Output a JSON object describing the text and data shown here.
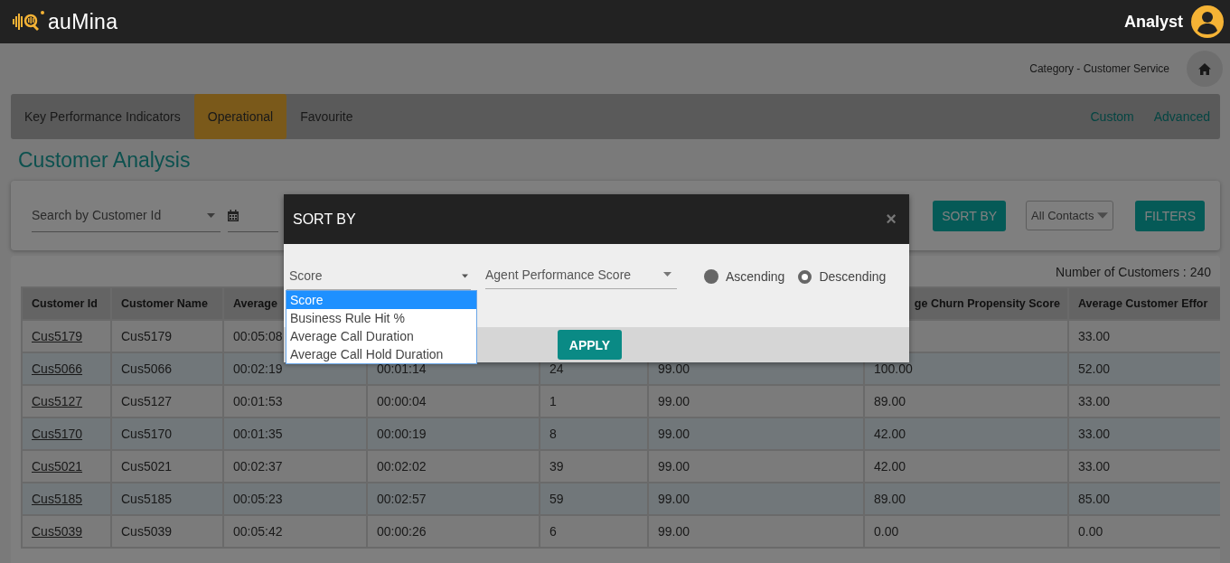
{
  "app": {
    "logo": "auMina",
    "user": "Analyst"
  },
  "breadcrumb": "Category - Customer Service",
  "tabs": [
    {
      "label": "Key Performance Indicators",
      "selected": false
    },
    {
      "label": "Operational",
      "selected": true
    },
    {
      "label": "Favourite",
      "selected": false
    }
  ],
  "view_links": [
    "Custom",
    "Advanced"
  ],
  "page_title": "Customer Analysis",
  "filters": {
    "search": {
      "placeholder": "Search by Customer Id"
    },
    "sort_button": "SORT BY",
    "contacts": {
      "value": "All Contacts"
    },
    "filters_button": "FILTERS"
  },
  "table": {
    "count": "Number of Customers : 240",
    "columns": [
      "Customer Id",
      "Customer Name",
      "Average",
      null,
      null,
      null,
      "ge Churn Propensity Score",
      "Average Customer Effor"
    ],
    "rows": [
      [
        "Cus5179",
        "Cus5179",
        "00:05:08",
        null,
        null,
        null,
        null,
        "33.00"
      ],
      [
        "Cus5066",
        "Cus5066",
        "00:02:19",
        "00:01:14",
        "24",
        "99.00",
        "100.00",
        "52.00"
      ],
      [
        "Cus5127",
        "Cus5127",
        "00:01:53",
        "00:00:04",
        "1",
        "99.00",
        "89.00",
        "33.00"
      ],
      [
        "Cus5170",
        "Cus5170",
        "00:01:35",
        "00:00:19",
        "8",
        "99.00",
        "42.00",
        "33.00"
      ],
      [
        "Cus5021",
        "Cus5021",
        "00:02:37",
        "00:02:02",
        "39",
        "99.00",
        "42.00",
        "33.00"
      ],
      [
        "Cus5185",
        "Cus5185",
        "00:05:23",
        "00:02:57",
        "59",
        "99.00",
        "89.00",
        "85.00"
      ],
      [
        "Cus5039",
        "Cus5039",
        "00:05:42",
        "00:00:26",
        "6",
        "99.00",
        "0.00",
        "0.00"
      ]
    ]
  },
  "sort_dialog": {
    "title": "SORT BY",
    "close": "×",
    "primary_select": {
      "value": "Score",
      "expanded": true,
      "options": [
        {
          "label": "Score",
          "selected": true
        },
        {
          "label": "Business Rule Hit %",
          "selected": false
        },
        {
          "label": "Average Call Duration",
          "selected": false
        },
        {
          "label": "Average Call Hold Duration",
          "selected": false
        }
      ]
    },
    "secondary_select": {
      "value": "Agent Performance Score"
    },
    "order": [
      {
        "label": "Ascending",
        "selected": false
      },
      {
        "label": "Descending",
        "selected": true
      }
    ],
    "apply": "APPLY"
  }
}
